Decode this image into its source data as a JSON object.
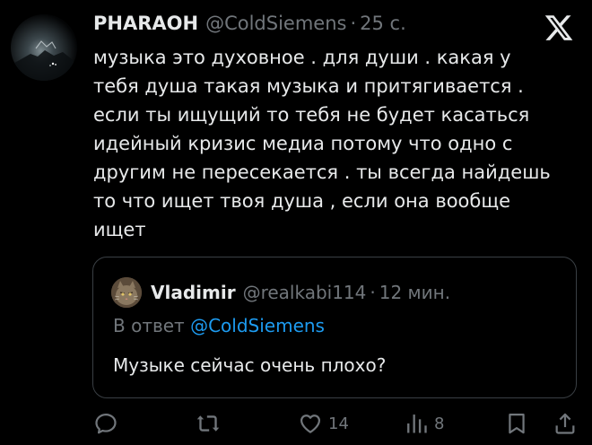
{
  "tweet": {
    "author_name": "PHARAOH",
    "handle": "@ColdSiemens",
    "separator": "·",
    "time": "25 с.",
    "text_lines": [
      "музыка это духовное . для души . какая у",
      "тебя душа такая музыка и притягивается .",
      "если ты ищущий то тебя не будет касаться",
      "идейный кризис медиа потому что одно с",
      "другим не пересекается . ты всегда найдешь",
      "то что ищет твоя душа , если она  вообще",
      "ищет"
    ]
  },
  "quoted": {
    "author_name": "Vladimir",
    "handle": "@realkabi114",
    "separator": "·",
    "time": "12 мин.",
    "reply_prefix": "В ответ",
    "reply_mention": "@ColdSiemens",
    "text": "Музыке сейчас очень плохо?"
  },
  "actions": {
    "reply_icon": "speech-bubble",
    "repost_icon": "repost-arrows",
    "like_icon": "heart",
    "like_count": "14",
    "views_icon": "bar-chart",
    "views_count": "8",
    "bookmark_icon": "bookmark",
    "share_icon": "share-upload"
  },
  "colors": {
    "background": "#000000",
    "text": "#e7e9ea",
    "muted": "#71767b",
    "link": "#1d9bf0",
    "border": "#3a3f44"
  }
}
